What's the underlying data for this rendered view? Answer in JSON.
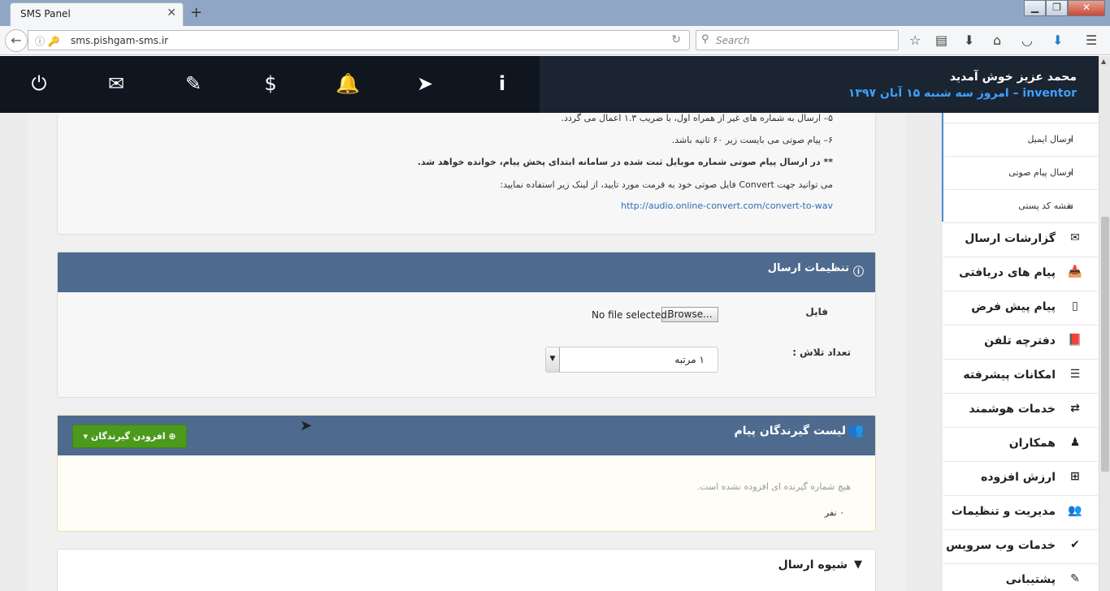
{
  "browser": {
    "tab_title": "SMS Panel",
    "tab_close": "✕",
    "new_tab": "+",
    "url": "sms.pishgam-sms.ir",
    "search_placeholder": "Search",
    "window_buttons": [
      "▁",
      "❐",
      "✕"
    ]
  },
  "header": {
    "welcome": "محمد عزیز خوش آمدید",
    "username": "inventor",
    "date": " – امروز سه شنبه ۱۵ آبان ۱۳۹۷",
    "icons": [
      "power-icon",
      "envelope-icon",
      "ticket-icon",
      "dollar-icon",
      "bell-icon",
      "paper-plane-icon",
      "info-icon"
    ]
  },
  "notes": {
    "line5": "۵– ارسال به شماره های غیر از همراه اول، با ضریب ۱.۳ اعمال می گردد.",
    "line6": "۶– پیام صوتی می بایست زیر ۶۰ ثانیه باشد.",
    "bold_note": "** در ارسال پیام صوتی شماره موبایل ثبت شده در سامانه ابتدای پخش پیام، خوانده خواهد شد.",
    "convert_note": "می توانید جهت Convert فایل صوتی خود به فرمت مورد تایید، از لینک زیر استفاده نمایید:",
    "convert_link": "http://audio.online-convert.com/convert-to-wav"
  },
  "send_settings": {
    "title": "تنظیمات ارسال",
    "file_label": "فایل",
    "browse_label": "Browse...",
    "file_status": "No file selected.",
    "attempts_label": "تعداد تلاش :",
    "attempts_value": "۱ مرتبه"
  },
  "recipients": {
    "title": "لیست گیرندگان پیام",
    "add_button": "افزودن گیرندگان",
    "empty_message": "هیچ شماره گیرنده ای افزوده نشده است.",
    "count": "۰ نفر"
  },
  "send_method": {
    "title": "شیوه ارسال"
  },
  "sidebar": {
    "sub_items": [
      {
        "label": "ارسال ایمیل"
      },
      {
        "label": "ارسال پیام صوتی"
      },
      {
        "label": "نقشه کد پستی"
      }
    ],
    "items": [
      {
        "label": "گزارشات ارسال",
        "icon": "envelope-icon",
        "glyph": "✉"
      },
      {
        "label": "پیام های دریافتی",
        "icon": "inbox-icon",
        "glyph": "📥"
      },
      {
        "label": "پیام پیش فرض",
        "icon": "tablet-icon",
        "glyph": "▯"
      },
      {
        "label": "دفترچه تلفن",
        "icon": "book-icon",
        "glyph": "📕"
      },
      {
        "label": "امکانات پیشرفته",
        "icon": "list-icon",
        "glyph": "☰"
      },
      {
        "label": "خدمات هوشمند",
        "icon": "retweet-icon",
        "glyph": "⇄"
      },
      {
        "label": "همکاران",
        "icon": "user-group-icon",
        "glyph": "♟"
      },
      {
        "label": "ارزش افزوده",
        "icon": "plus-square-icon",
        "glyph": "⊞"
      },
      {
        "label": "مدیریت و تنظیمات",
        "icon": "users-icon",
        "glyph": "👥"
      },
      {
        "label": "خدمات وب سرویس",
        "icon": "check-circle-icon",
        "glyph": "✔"
      },
      {
        "label": "پشتیبانی",
        "icon": "ticket-icon",
        "glyph": "✎"
      }
    ]
  },
  "colors": {
    "header_bg": "#1b2431",
    "panel_head": "#4e6a8e",
    "accent_blue": "#3da1ff",
    "add_button_green": "#4b9a1c"
  }
}
